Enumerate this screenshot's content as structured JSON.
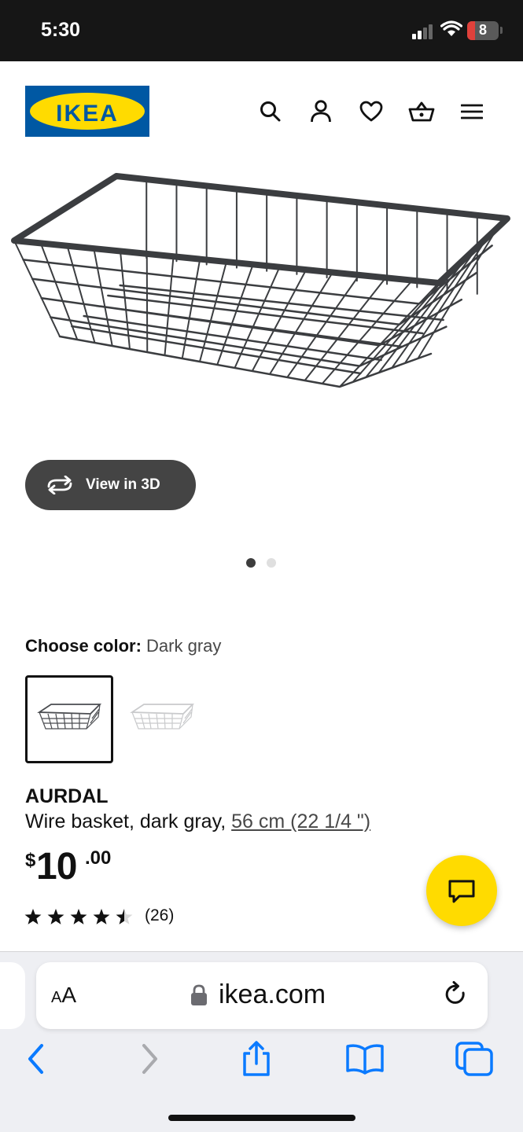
{
  "status_bar": {
    "time": "5:30",
    "battery_level": "8"
  },
  "header": {
    "logo_text": "IKEA",
    "icons": [
      "search-icon",
      "account-icon",
      "heart-icon",
      "basket-icon",
      "menu-icon"
    ]
  },
  "gallery": {
    "view_3d_label": "View in 3D",
    "image_count": 2,
    "active_image": 1
  },
  "color_chooser": {
    "label": "Choose color:",
    "selected_value": "Dark gray",
    "options": [
      "Dark gray",
      "White"
    ]
  },
  "product": {
    "name": "AURDAL",
    "description": "Wire basket, dark gray, ",
    "size_link": "56 cm (22 1/4 \")",
    "price_symbol": "$",
    "price_integer": "10",
    "price_decimal": ".00",
    "rating": 4.5,
    "review_count": "(26)"
  },
  "browser": {
    "aa_small": "A",
    "aa_large": "A",
    "url": "ikea.com"
  },
  "colors": {
    "brand_blue": "#0058a3",
    "brand_yellow": "#ffdb00",
    "ios_blue": "#0a7aff"
  }
}
